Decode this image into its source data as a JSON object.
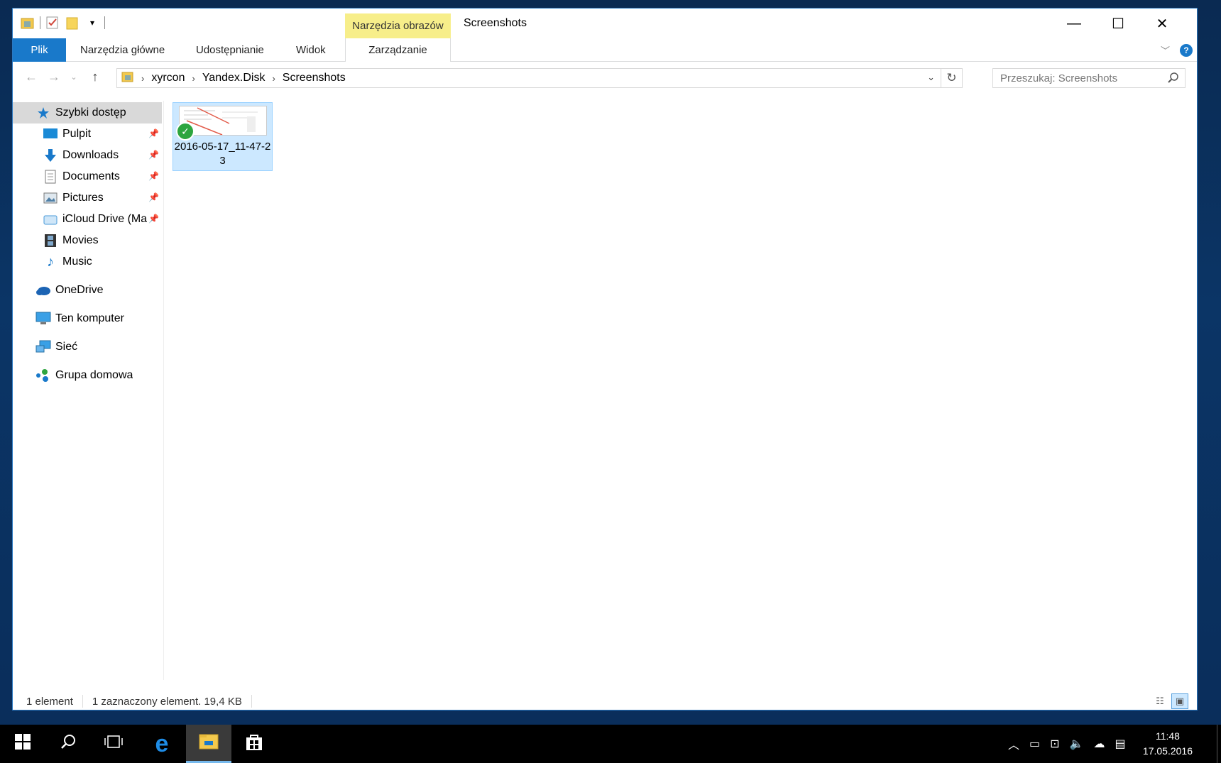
{
  "window": {
    "title": "Screenshots",
    "context_tab_group": "Narzędzia obrazów",
    "controls": {
      "minimize": "—",
      "maximize": "☐",
      "close": "✕"
    }
  },
  "ribbon": {
    "tabs": [
      {
        "label": "Plik"
      },
      {
        "label": "Narzędzia główne"
      },
      {
        "label": "Udostępnianie"
      },
      {
        "label": "Widok"
      }
    ],
    "context_tab": "Zarządzanie",
    "help": "?"
  },
  "navigation": {
    "breadcrumb": [
      "xyrcon",
      "Yandex.Disk",
      "Screenshots"
    ],
    "search_placeholder": "Przeszukaj: Screenshots"
  },
  "sidebar": {
    "items": [
      {
        "label": "Szybki dostęp",
        "icon": "star-icon",
        "pinned": false,
        "selected": true
      },
      {
        "label": "Pulpit",
        "icon": "desktop-icon",
        "pinned": true
      },
      {
        "label": "Downloads",
        "icon": "download-arrow-icon",
        "pinned": true
      },
      {
        "label": "Documents",
        "icon": "document-icon",
        "pinned": true
      },
      {
        "label": "Pictures",
        "icon": "pictures-icon",
        "pinned": true
      },
      {
        "label": "iCloud Drive (Ma",
        "icon": "icloud-icon",
        "pinned": true
      },
      {
        "label": "Movies",
        "icon": "film-icon",
        "pinned": false
      },
      {
        "label": "Music",
        "icon": "music-note-icon",
        "pinned": false
      },
      {
        "label": "OneDrive",
        "icon": "onedrive-cloud-icon"
      },
      {
        "label": "Ten komputer",
        "icon": "computer-icon"
      },
      {
        "label": "Sieć",
        "icon": "network-icon"
      },
      {
        "label": "Grupa domowa",
        "icon": "homegroup-icon"
      }
    ]
  },
  "content": {
    "files": [
      {
        "name": "2016-05-17_11-47-23",
        "synced": true,
        "selected": true
      }
    ]
  },
  "statusbar": {
    "count": "1 element",
    "selection": "1 zaznaczony element. 19,4 KB"
  },
  "taskbar": {
    "time": "11:48",
    "date": "17.05.2016"
  },
  "colors": {
    "accent": "#1979ca",
    "context_tab": "#f7ee8a",
    "selection": "#cce8ff",
    "sync_ok": "#2ea53f"
  }
}
